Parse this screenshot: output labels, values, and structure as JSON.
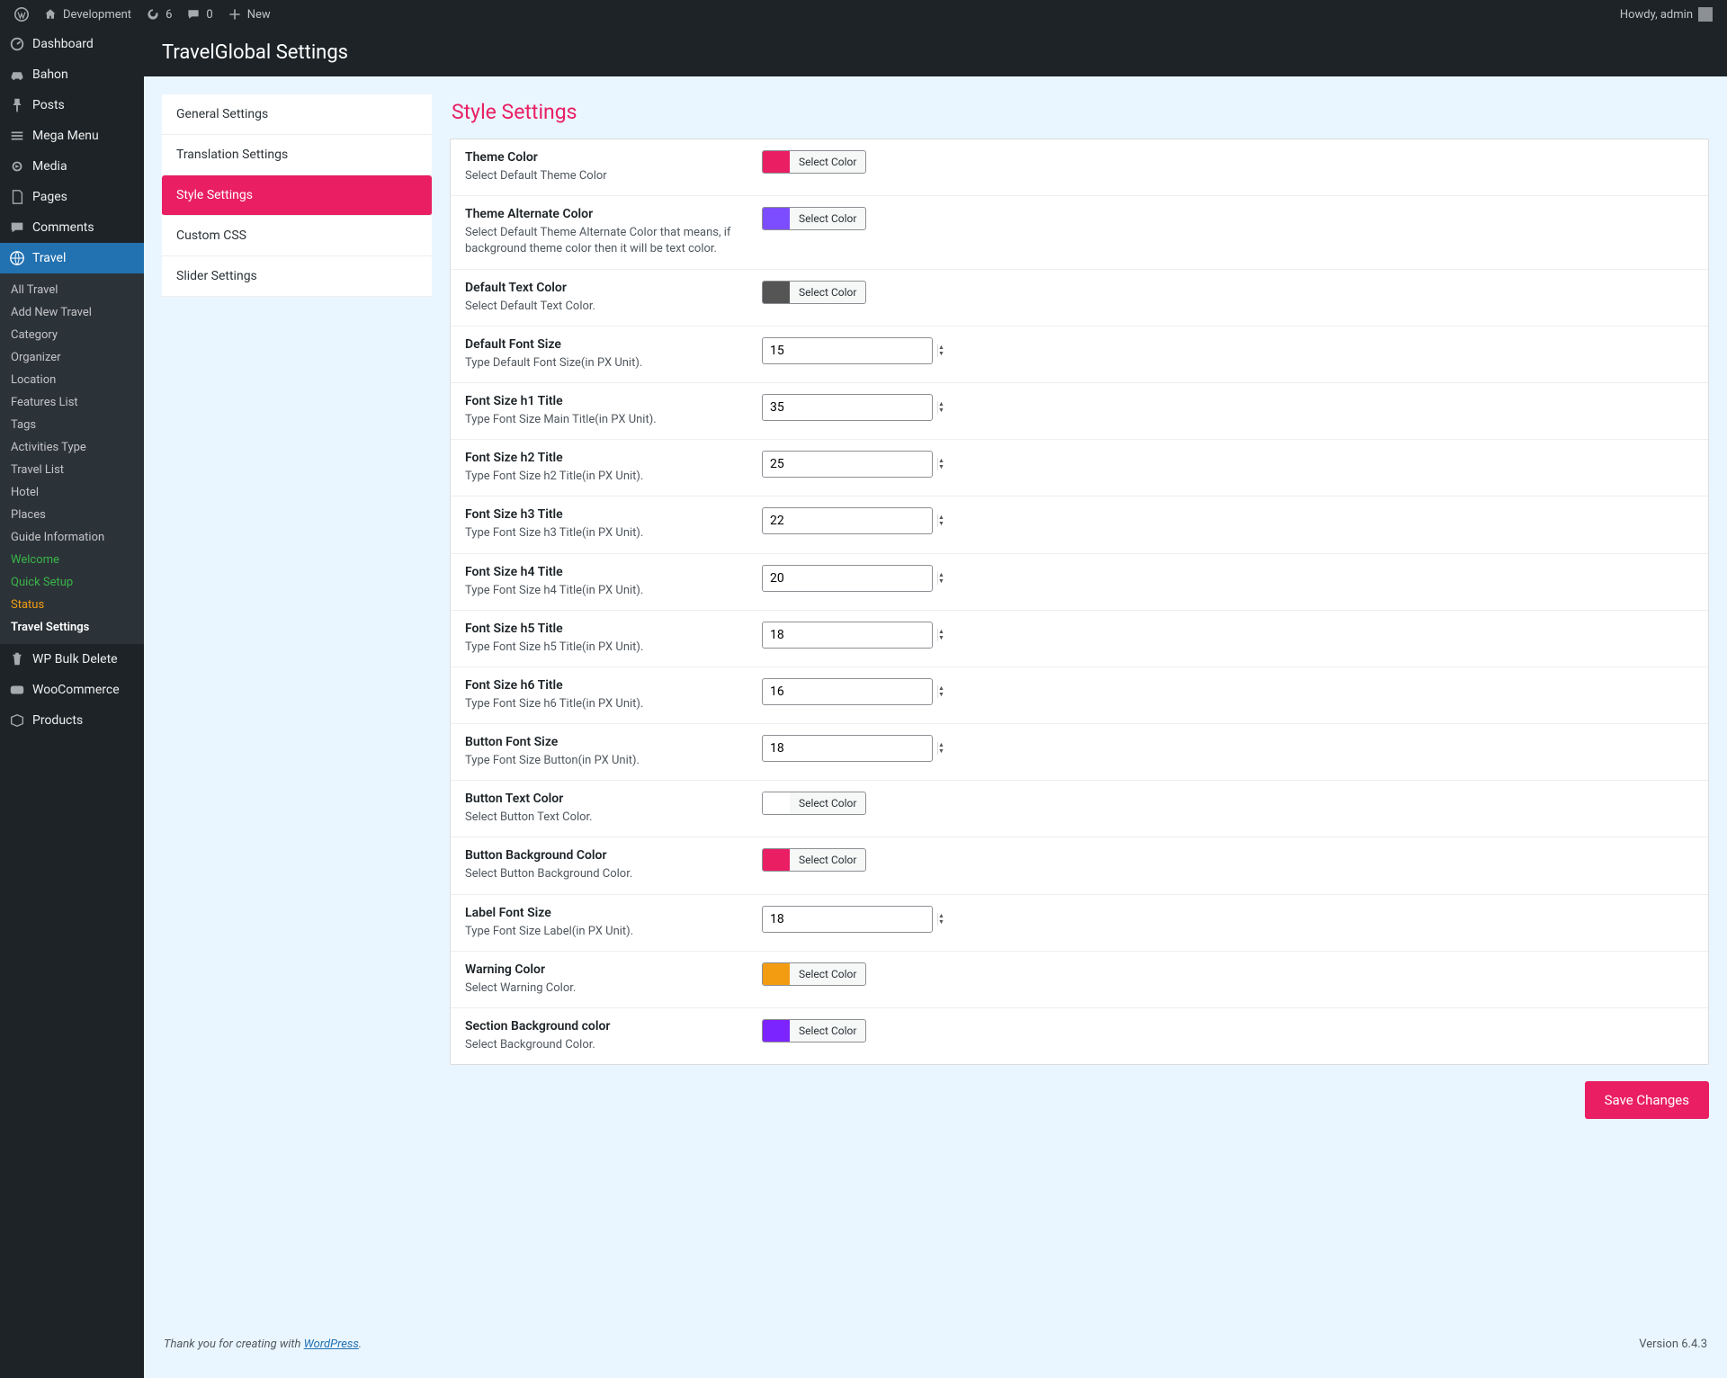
{
  "adminbar": {
    "site_name": "Development",
    "updates_count": "6",
    "comments_count": "0",
    "new_label": "New",
    "howdy": "Howdy, admin"
  },
  "adminmenu": {
    "dashboard": "Dashboard",
    "bahon": "Bahon",
    "posts": "Posts",
    "mega_menu": "Mega Menu",
    "media": "Media",
    "pages": "Pages",
    "comments": "Comments",
    "travel": "Travel",
    "travel_sub": {
      "all_travel": "All Travel",
      "add_new": "Add New Travel",
      "category": "Category",
      "organizer": "Organizer",
      "location": "Location",
      "features": "Features List",
      "tags": "Tags",
      "activities": "Activities Type",
      "travel_list": "Travel List",
      "hotel": "Hotel",
      "places": "Places",
      "guide": "Guide Information",
      "welcome": "Welcome",
      "quick_setup": "Quick Setup",
      "status": "Status",
      "travel_settings": "Travel Settings"
    },
    "wp_bulk_delete": "WP Bulk Delete",
    "woocommerce": "WooCommerce",
    "products": "Products"
  },
  "page": {
    "header": "TravelGlobal Settings"
  },
  "tabs": {
    "general": "General Settings",
    "translation": "Translation Settings",
    "style": "Style Settings",
    "custom_css": "Custom CSS",
    "slider": "Slider Settings"
  },
  "panel": {
    "title": "Style Settings",
    "select_color": "Select Color",
    "save": "Save Changes"
  },
  "rows": {
    "theme_color": {
      "label": "Theme Color",
      "desc": "Select Default Theme Color",
      "color": "#e91e63"
    },
    "theme_alt_color": {
      "label": "Theme Alternate Color",
      "desc": "Select Default Theme Alternate Color that means, if background theme color then it will be text color.",
      "color": "#7c4dff"
    },
    "default_text_color": {
      "label": "Default Text Color",
      "desc": "Select Default Text Color.",
      "color": "#555555"
    },
    "default_font": {
      "label": "Default Font Size",
      "desc": "Type Default Font Size(in PX Unit).",
      "value": "15"
    },
    "h1": {
      "label": "Font Size h1 Title",
      "desc": "Type Font Size Main Title(in PX Unit).",
      "value": "35"
    },
    "h2": {
      "label": "Font Size h2 Title",
      "desc": "Type Font Size h2 Title(in PX Unit).",
      "value": "25"
    },
    "h3": {
      "label": "Font Size h3 Title",
      "desc": "Type Font Size h3 Title(in PX Unit).",
      "value": "22"
    },
    "h4": {
      "label": "Font Size h4 Title",
      "desc": "Type Font Size h4 Title(in PX Unit).",
      "value": "20"
    },
    "h5": {
      "label": "Font Size h5 Title",
      "desc": "Type Font Size h5 Title(in PX Unit).",
      "value": "18"
    },
    "h6": {
      "label": "Font Size h6 Title",
      "desc": "Type Font Size h6 Title(in PX Unit).",
      "value": "16"
    },
    "button_font": {
      "label": "Button Font Size",
      "desc": "Type Font Size Button(in PX Unit).",
      "value": "18"
    },
    "button_text_color": {
      "label": "Button Text Color",
      "desc": "Select Button Text Color.",
      "color": "#ffffff"
    },
    "button_bg_color": {
      "label": "Button Background Color",
      "desc": "Select Button Background Color.",
      "color": "#e91e63"
    },
    "label_font": {
      "label": "Label Font Size",
      "desc": "Type Font Size Label(in PX Unit).",
      "value": "18"
    },
    "warning_color": {
      "label": "Warning Color",
      "desc": "Select Warning Color.",
      "color": "#f39c12"
    },
    "section_bg": {
      "label": "Section Background color",
      "desc": "Select Background Color.",
      "color": "#7c24ff"
    }
  },
  "footer": {
    "thanks_pre": "Thank you for creating with ",
    "wp": "WordPress",
    "thanks_post": ".",
    "version": "Version 6.4.3"
  }
}
